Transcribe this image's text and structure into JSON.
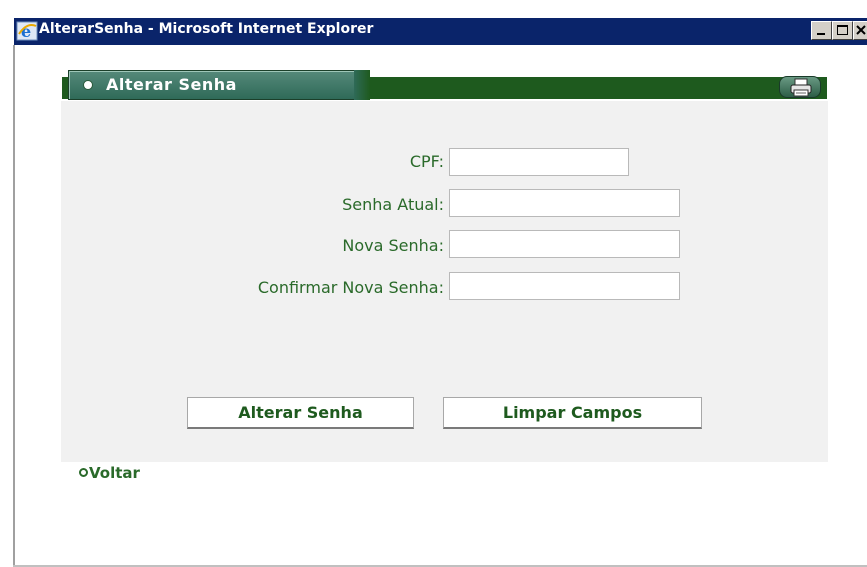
{
  "window": {
    "title": "AlterarSenha - Microsoft Internet Explorer",
    "icon": "ie-icon",
    "controls": [
      "minimize-icon",
      "maximize-icon",
      "close-icon"
    ]
  },
  "panel": {
    "title": "Alterar Senha",
    "print_icon": "printer-icon"
  },
  "form": {
    "cpf": {
      "label": "CPF:",
      "value": ""
    },
    "senha_atual": {
      "label": "Senha Atual:",
      "value": ""
    },
    "nova_senha": {
      "label": "Nova Senha:",
      "value": ""
    },
    "confirmar": {
      "label": "Confirmar Nova Senha:",
      "value": ""
    }
  },
  "buttons": {
    "alterar": "Alterar Senha",
    "limpar": "Limpar Campos"
  },
  "back_link": "Voltar",
  "colors": {
    "titlebar": "#0a246a",
    "header_green": "#1e5a1e",
    "label_green": "#2a6a2a",
    "panel_bg": "#f1f1f1"
  }
}
